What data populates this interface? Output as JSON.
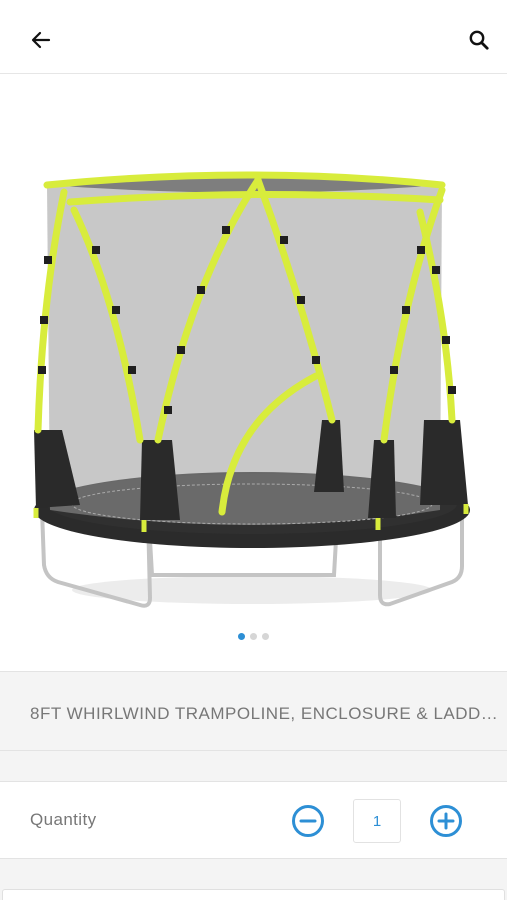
{
  "header": {
    "back_icon": "arrow-left-icon",
    "search_icon": "search-icon"
  },
  "gallery": {
    "image_subject": "trampoline",
    "slide_count": 3,
    "active_slide": 1
  },
  "product": {
    "title": "8FT WHIRLWIND TRAMPOLINE, ENCLOSURE & LADDE..."
  },
  "quantity": {
    "label": "Quantity",
    "value": "1",
    "minus_icon": "minus-circle-icon",
    "plus_icon": "plus-circle-icon"
  },
  "colors": {
    "accent": "#2d8fd5",
    "text": "#777777",
    "band": "#f4f4f4",
    "frame_yellow": "#d8ec3c",
    "net_grey": "#8e8e8e",
    "mat_dark": "#2b2b2b"
  }
}
